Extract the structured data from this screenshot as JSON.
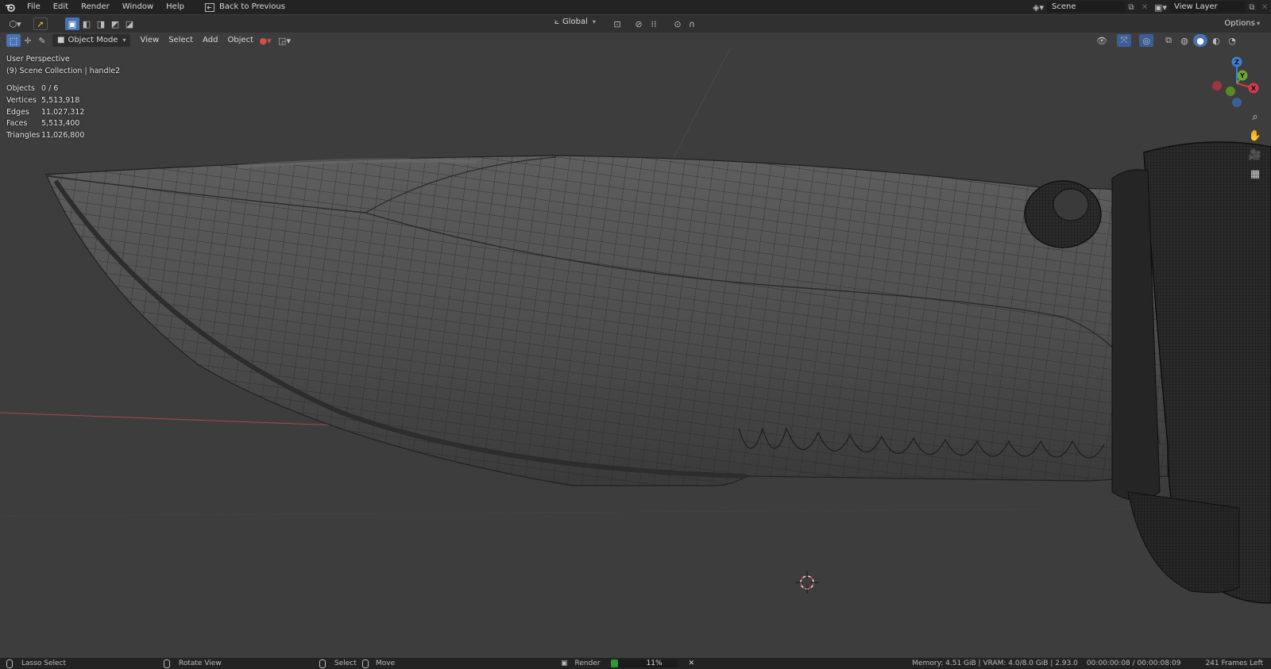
{
  "menubar": {
    "items": [
      "File",
      "Edit",
      "Render",
      "Window",
      "Help"
    ],
    "back_label": "Back to Previous",
    "scene_name": "Scene",
    "view_layer": "View Layer"
  },
  "header": {
    "orientation": "Global",
    "options_label": "Options"
  },
  "viewport_header": {
    "mode": "Object Mode",
    "menus": [
      "View",
      "Select",
      "Add",
      "Object"
    ]
  },
  "overlay": {
    "view_name": "User Perspective",
    "collection": "(9) Scene Collection | handle2",
    "stats": [
      {
        "label": "Objects",
        "value": "0 / 6"
      },
      {
        "label": "Vertices",
        "value": "5,513,918"
      },
      {
        "label": "Edges",
        "value": "11,027,312"
      },
      {
        "label": "Faces",
        "value": "5,513,400"
      },
      {
        "label": "Triangles",
        "value": "11,026,800"
      }
    ]
  },
  "gizmo": {
    "x": "X",
    "y": "Y",
    "z": "Z"
  },
  "statusbar": {
    "lasso": "Lasso Select",
    "rotate": "Rotate View",
    "select": "Select",
    "move": "Move",
    "render_label": "Render",
    "render_progress_text": "11%",
    "render_progress": 0.11,
    "memory": "Memory: 4.51 GiB | VRAM: 4.0/8.0 GiB | 2.93.0",
    "time": "00:00:00:08 / 00:00:08:09",
    "frames_left": "241 Frames Left"
  },
  "colors": {
    "accent": "#4772b3",
    "progress": "#2a9a35",
    "axis_x": "#d8394a",
    "axis_y": "#6ea52e",
    "axis_z": "#3b7fd1"
  }
}
